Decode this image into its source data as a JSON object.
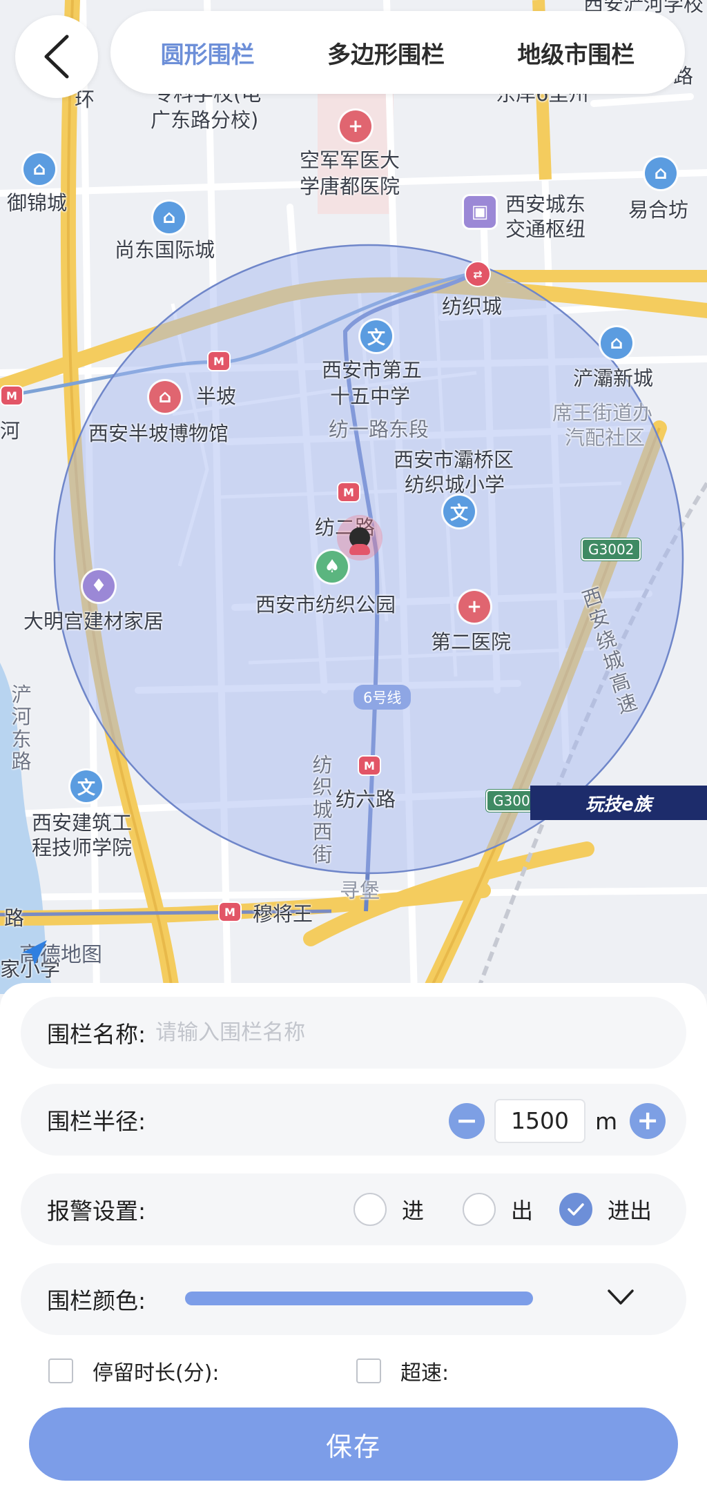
{
  "tabs": [
    {
      "label": "圆形围栏",
      "active": true
    },
    {
      "label": "多边形围栏",
      "active": false
    },
    {
      "label": "地级市围栏",
      "active": false
    }
  ],
  "map": {
    "labels": {
      "top_partial": "西安浐河学校",
      "top_road_partial": "路",
      "zhuanke": "专科学校(电",
      "guangdong": "广东路分校)",
      "dongan": "东岸6里州",
      "huan": "环",
      "air_force_1": "空军军医大",
      "air_force_2": "学唐都医院",
      "yujincheng": "御锦城",
      "transit_1": "西安城东",
      "transit_2": "交通枢纽",
      "yihefang": "易合坊",
      "shangdong": "尚东国际城",
      "fangzhicheng": "纺织城",
      "chanba": "浐灞新城",
      "banpo": "半坡",
      "school55_1": "西安市第五",
      "school55_2": "十五中学",
      "xiwang_1": "席王街道办",
      "xiwang_2": "汽配社区",
      "he": "河",
      "banpo_museum": "西安半坡博物馆",
      "fangyi_road": "纺一路东段",
      "baqiao_1": "西安市灞桥区",
      "baqiao_2": "纺织城小学",
      "fanger": "纺二路",
      "g3002": "G3002",
      "daminggong": "大明宫建材家居",
      "fangzhi_park": "西安市纺织公园",
      "second_hospital": "第二医院",
      "line6": "6号线",
      "raocheng": "西安绕城高速",
      "chanhe_east": "浐河东路",
      "fangzhicheng_west": "纺织城西街",
      "fangliu": "纺六路",
      "g300": "G300",
      "architect_1": "西安建筑工",
      "architect_2": "程技师学院",
      "xunbao": "寻堡",
      "lu_left": "路",
      "mujiangwang": "穆将王",
      "jia_xiao": "家小学",
      "amap": "高德地图",
      "watermark": "玩技e族"
    }
  },
  "form": {
    "name": {
      "label": "围栏名称:",
      "placeholder": "请输入围栏名称",
      "value": ""
    },
    "radius": {
      "label": "围栏半径:",
      "value": "1500",
      "unit": "m",
      "minus": "−",
      "plus": "+"
    },
    "alarm": {
      "label": "报警设置:",
      "options": [
        {
          "label": "进",
          "checked": false
        },
        {
          "label": "出",
          "checked": false
        },
        {
          "label": "进出",
          "checked": true
        }
      ]
    },
    "color": {
      "label": "围栏颜色:",
      "value": "#7c9de8"
    },
    "stay": {
      "label": "停留时长(分):",
      "checked": false
    },
    "speed": {
      "label": "超速:",
      "checked": false
    }
  },
  "save_label": "保存",
  "colors": {
    "accent": "#6d8fd8",
    "fence_fill": "#9fb3f0",
    "fence_stroke": "#6f86c9",
    "save_bg": "#7c9de8"
  }
}
